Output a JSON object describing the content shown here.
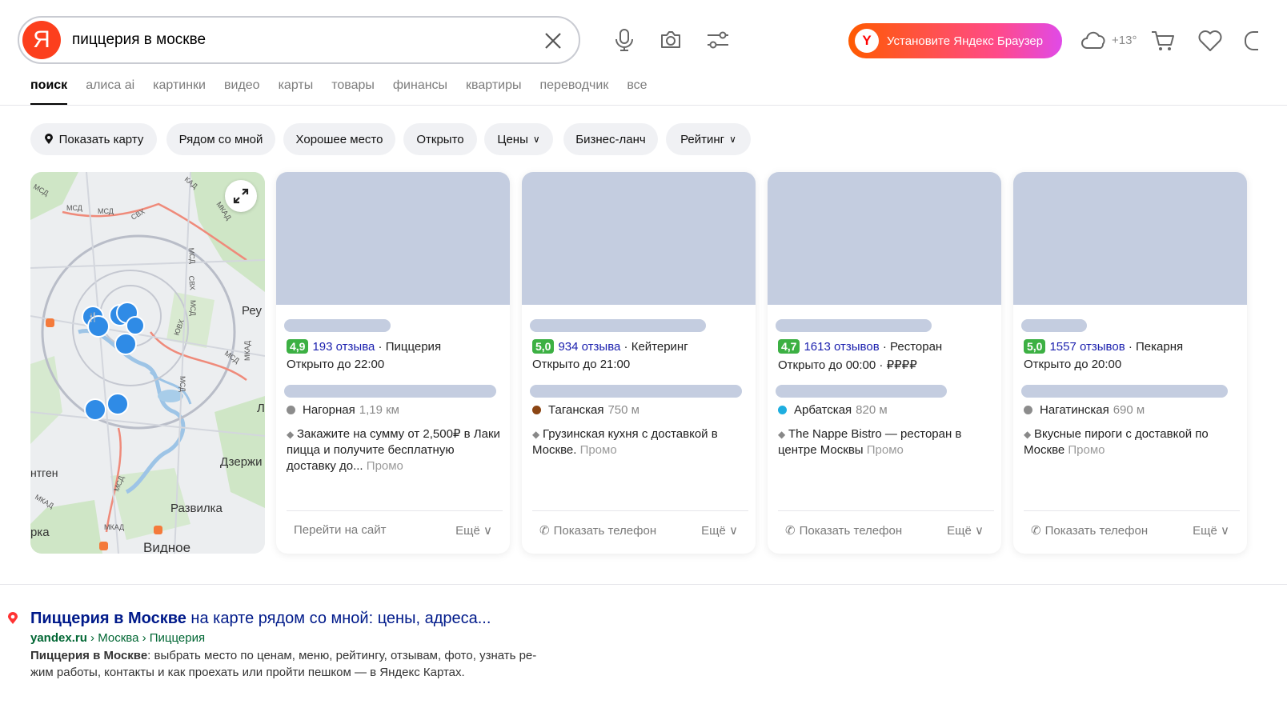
{
  "search": {
    "logo": "Я",
    "query": "пиццерия в москве"
  },
  "header": {
    "browser_cta": "Установите Яндекс Браузер",
    "browser_logo": "Y",
    "weather": "+13°"
  },
  "tabs": [
    "поиск",
    "алиса ai",
    "картинки",
    "видео",
    "карты",
    "товары",
    "финансы",
    "квартиры",
    "переводчик",
    "все"
  ],
  "filters": [
    "Показать карту",
    "Рядом со мной",
    "Хорошее место",
    "Открыто",
    "Цены",
    "Бизнес-ланч",
    "Рейтинг"
  ],
  "map": {
    "labels": [
      "МСД",
      "МСД",
      "МСД",
      "СВХ",
      "КАД",
      "МКАД",
      "МСД",
      "СВХ",
      "МСД",
      "Реу",
      "ЮВХ",
      "МСД",
      "МКАД",
      "МСД",
      "Л",
      "Дзержи",
      "нтген",
      "МКАД",
      "МСД",
      "МКАД",
      "Развилка",
      "рка",
      "Видное"
    ]
  },
  "cards": [
    {
      "rating": "4,9",
      "reviews": "193 отзыва",
      "category": "Пиццерия",
      "hours": "Открыто до 22:00",
      "metro": "Нагорная",
      "metro_color": "#8c8c8c",
      "distance": "1,19 км",
      "promo": "Закажите на сумму от 2,500₽ в Лаки пицца и получите бесплатную доставку до...",
      "promo_label": "Промо",
      "action": "Перейти на сайт",
      "more": "Ещё"
    },
    {
      "rating": "5,0",
      "reviews": "934 отзыва",
      "category": "Кейтеринг",
      "hours": "Открыто до 21:00",
      "metro": "Таганская",
      "metro_color": "#8b4513",
      "distance": "750 м",
      "promo": "Грузинская кухня с доставкой в Москве.",
      "promo_label": "Промо",
      "action": "Показать телефон",
      "more": "Ещё"
    },
    {
      "rating": "4,7",
      "reviews": "1613 отзывов",
      "category": "Ресторан",
      "hours": "Открыто до 00:00 · ₽₽₽₽",
      "metro": "Арбатская",
      "metro_color": "#1eaee0",
      "distance": "820 м",
      "promo": "The Nappe Bistro — ресторан в центре Москвы",
      "promo_label": "Промо",
      "action": "Показать телефон",
      "more": "Ещё"
    },
    {
      "rating": "5,0",
      "reviews": "1557 отзывов",
      "category": "Пекарня",
      "hours": "Открыто до 20:00",
      "metro": "Нагатинская",
      "metro_color": "#8c8c8c",
      "distance": "690 м",
      "promo": "Вкусные пироги с доставкой по Москве",
      "promo_label": "Промо",
      "action": "Показать телефон",
      "more": "Ещё"
    }
  ],
  "result": {
    "title_bold": "Пиццерия в Москве",
    "title_rest": " на карте рядом со мной: цены, адреса...",
    "url_domain": "yandex.ru",
    "url_path": " › Москва › Пиццерия",
    "snippet_bold": "Пиццерия в Москве",
    "snippet_rest": ": выбрать место по ценам, меню, рейтингу, отзывам, фото, узнать ре-жим работы, контакты и как проехать или пройти пешком — в Яндекс Картах."
  }
}
